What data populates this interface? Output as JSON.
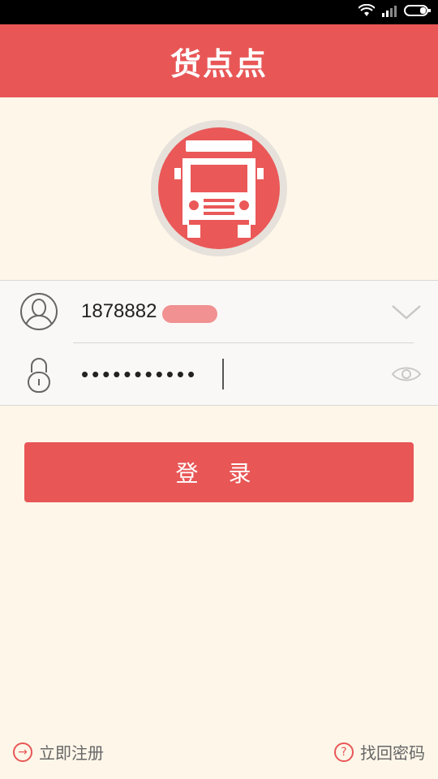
{
  "app": {
    "title": "货点点"
  },
  "login": {
    "username_value": "1878882",
    "password_value": "•••••••••••",
    "button_label": "登 录"
  },
  "footer": {
    "register_label": "立即注册",
    "forgot_label": "找回密码"
  },
  "colors": {
    "brand": "#e85656",
    "background": "#fdf6e9"
  },
  "icons": {
    "status": [
      "wifi-icon",
      "signal-icon",
      "battery-icon"
    ],
    "logo": "truck-icon",
    "user": "user-icon",
    "lock": "lock-icon",
    "dropdown": "chevron-down-icon",
    "show_password": "eye-icon",
    "register": "arrow-right-circle-icon",
    "forgot": "question-circle-icon"
  }
}
